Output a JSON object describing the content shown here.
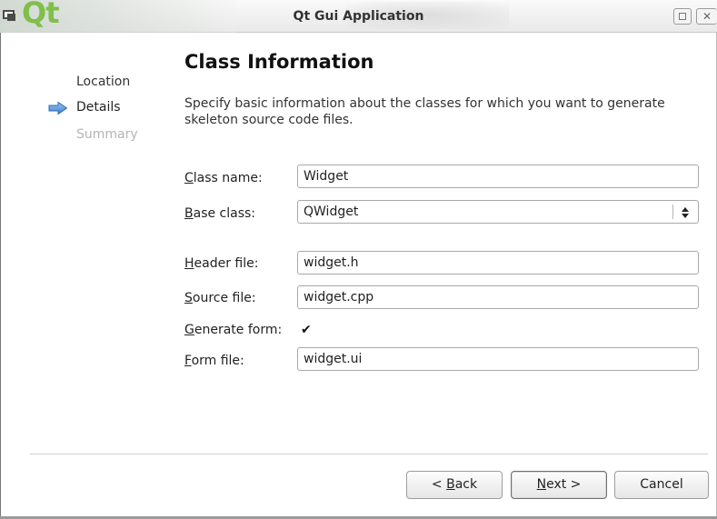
{
  "window": {
    "title": "Qt Gui Application",
    "logo_text": "Qt"
  },
  "steps": {
    "location": "Location",
    "details": "Details",
    "summary": "Summary",
    "current_indicator": "arrow-right-icon"
  },
  "page": {
    "heading": "Class Information",
    "description": "Specify basic information about the classes for which you want to generate skeleton source code files."
  },
  "form": {
    "class_name": {
      "label_mnemonic": "C",
      "label_rest": "lass name:",
      "value": "Widget"
    },
    "base_class": {
      "label_mnemonic": "B",
      "label_rest": "ase class:",
      "value": "QWidget"
    },
    "header_file": {
      "label_mnemonic": "H",
      "label_rest": "eader file:",
      "value": "widget.h"
    },
    "source_file": {
      "label_mnemonic": "S",
      "label_rest": "ource file:",
      "value": "widget.cpp"
    },
    "generate_form": {
      "label_mnemonic": "G",
      "label_rest": "enerate form:",
      "checked": true,
      "check_glyph": "✔"
    },
    "form_file": {
      "label_mnemonic": "F",
      "label_rest": "orm file:",
      "value": "widget.ui"
    }
  },
  "buttons": {
    "back_prefix": "< ",
    "back_mnemonic": "B",
    "back_rest": "ack",
    "next_mnemonic": "N",
    "next_rest": "ext >",
    "cancel": "Cancel"
  },
  "colors": {
    "accent_arrow": "#4a90d9",
    "qt_green": "#7fbf4a",
    "disabled_text": "#b5b5b5"
  }
}
